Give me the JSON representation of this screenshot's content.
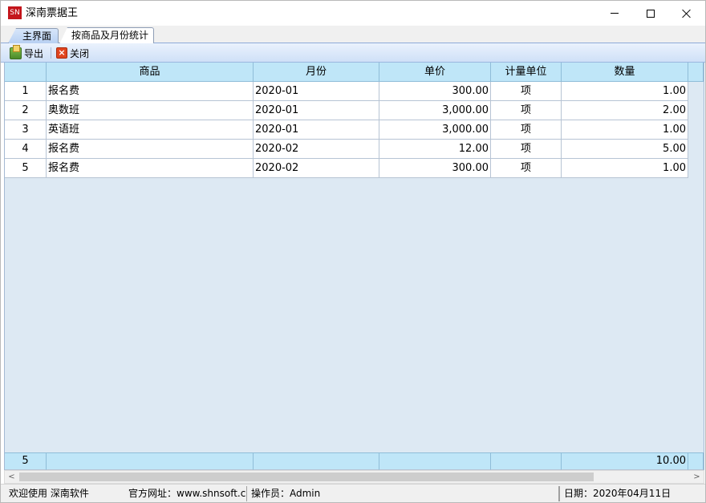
{
  "window": {
    "app_icon_text": "SN",
    "title": "深南票据王"
  },
  "tabs": [
    {
      "label": "主界面",
      "active": false
    },
    {
      "label": "按商品及月份统计",
      "active": true
    }
  ],
  "toolbar": {
    "export_label": "导出",
    "close_label": "关闭"
  },
  "table": {
    "columns": [
      "",
      "商品",
      "月份",
      "单价",
      "计量单位",
      "数量"
    ],
    "rows": [
      {
        "index": "1",
        "product": "报名费",
        "month": "2020-01",
        "price": "300.00",
        "unit": "项",
        "qty": "1.00"
      },
      {
        "index": "2",
        "product": "奥数班",
        "month": "2020-01",
        "price": "3,000.00",
        "unit": "项",
        "qty": "2.00"
      },
      {
        "index": "3",
        "product": "英语班",
        "month": "2020-01",
        "price": "3,000.00",
        "unit": "项",
        "qty": "1.00"
      },
      {
        "index": "4",
        "product": "报名费",
        "month": "2020-02",
        "price": "12.00",
        "unit": "项",
        "qty": "5.00"
      },
      {
        "index": "5",
        "product": "报名费",
        "month": "2020-02",
        "price": "300.00",
        "unit": "项",
        "qty": "1.00"
      }
    ],
    "footer": {
      "count": "5",
      "qty_total": "10.00"
    }
  },
  "statusbar": {
    "welcome": "欢迎使用 深南软件",
    "website": "官方网址：www.shnsoft.com",
    "operator": "操作员：Admin",
    "date": "日期：2020年04月11日"
  },
  "scrollbar": {
    "left_arrow": "<",
    "right_arrow": ">"
  }
}
